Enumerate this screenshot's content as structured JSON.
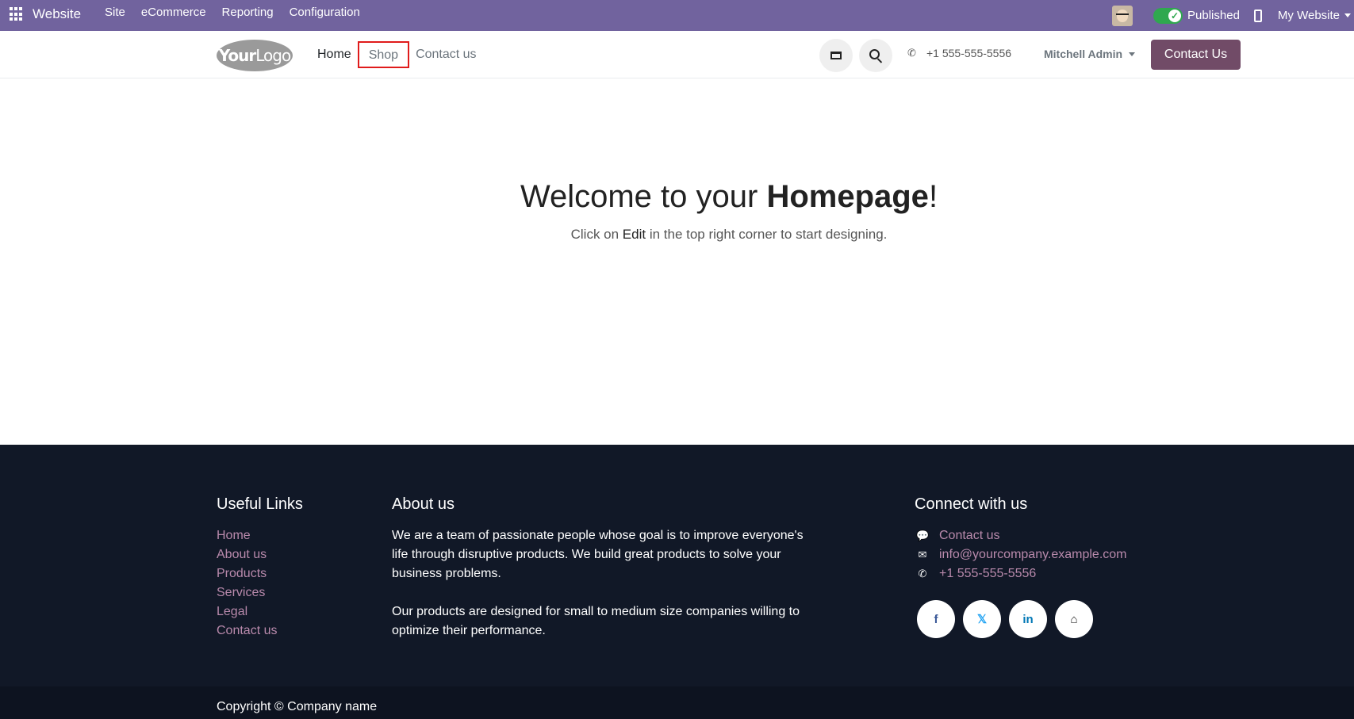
{
  "admin_bar": {
    "brand": "Website",
    "menu": [
      "Site",
      "eCommerce",
      "Reporting",
      "Configuration"
    ],
    "published_label": "Published",
    "website_selector": "My Website",
    "color": "#71639e"
  },
  "header": {
    "logo_bold": "Your",
    "logo_light": "Logo",
    "nav": [
      "Home",
      "Shop",
      "Contact us"
    ],
    "phone": "+1 555-555-5556",
    "user": "Mitchell Admin",
    "cta_label": "Contact Us",
    "cta_color": "#714b67"
  },
  "hero": {
    "title_pre": "Welcome to your ",
    "title_bold": "Homepage",
    "title_post": "!",
    "sub_pre": "Click on ",
    "sub_edit": "Edit",
    "sub_post": " in the top right corner to start designing."
  },
  "footer": {
    "useful_links_title": "Useful Links",
    "useful_links": [
      "Home",
      "About us",
      "Products",
      "Services",
      "Legal",
      "Contact us"
    ],
    "about_title": "About us",
    "about_p1": "We are a team of passionate people whose goal is to improve everyone's life through disruptive products. We build great products to solve your business problems.",
    "about_p2": "Our products are designed for small to medium size companies willing to optimize their performance.",
    "connect_title": "Connect with us",
    "connect_contact": "Contact us",
    "connect_email": "info@yourcompany.example.com",
    "connect_phone": "+1 555-555-5556",
    "socials": [
      "facebook-icon",
      "x-twitter-icon",
      "linkedin-icon",
      "home-icon"
    ],
    "copyright": "Copyright © Company name",
    "bg_color": "#111827"
  }
}
